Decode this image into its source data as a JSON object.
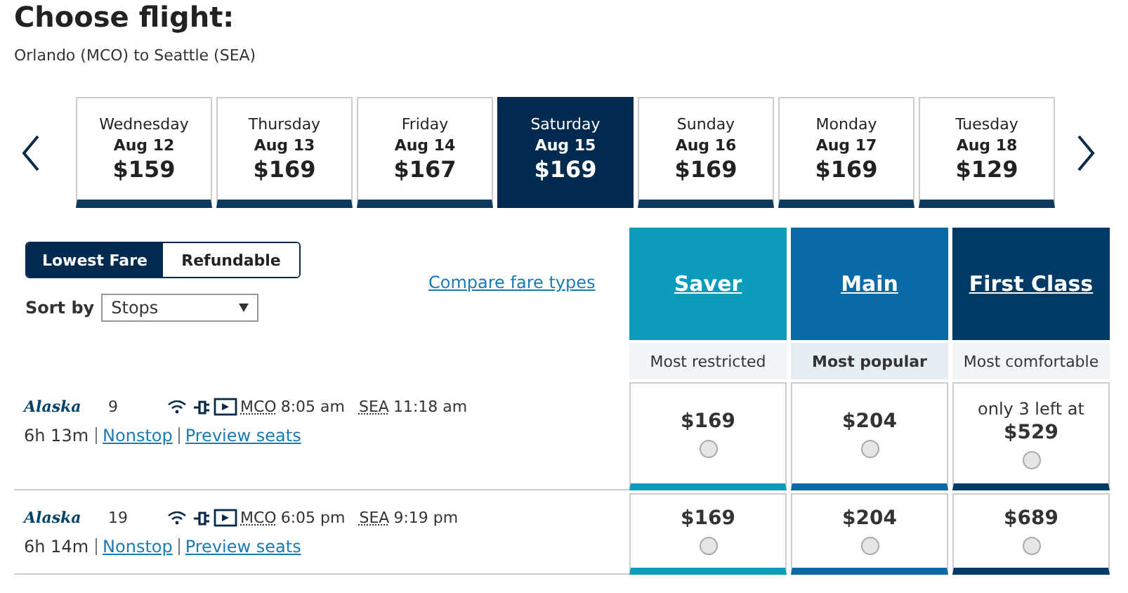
{
  "title": "Choose flight:",
  "route": "Orlando (MCO) to Seattle (SEA)",
  "dates": [
    {
      "day": "Wednesday",
      "date": "Aug 12",
      "price": "$159",
      "selected": false
    },
    {
      "day": "Thursday",
      "date": "Aug 13",
      "price": "$169",
      "selected": false
    },
    {
      "day": "Friday",
      "date": "Aug 14",
      "price": "$167",
      "selected": false
    },
    {
      "day": "Saturday",
      "date": "Aug 15",
      "price": "$169",
      "selected": true
    },
    {
      "day": "Sunday",
      "date": "Aug 16",
      "price": "$169",
      "selected": false
    },
    {
      "day": "Monday",
      "date": "Aug 17",
      "price": "$169",
      "selected": false
    },
    {
      "day": "Tuesday",
      "date": "Aug 18",
      "price": "$129",
      "selected": false
    }
  ],
  "fare_toggle": [
    {
      "label": "Lowest Fare",
      "selected": true
    },
    {
      "label": "Refundable",
      "selected": false
    }
  ],
  "sort": {
    "label": "Sort by",
    "value": "Stops"
  },
  "compare_link": "Compare fare types",
  "fare_columns": [
    {
      "name": "Saver",
      "subtitle": "Most restricted",
      "highlighted": false,
      "color": "#0a9cba"
    },
    {
      "name": "Main",
      "subtitle": "Most popular",
      "highlighted": true,
      "color": "#0a6aa6"
    },
    {
      "name": "First Class",
      "subtitle": "Most comfortable",
      "highlighted": false,
      "color": "#003a66"
    }
  ],
  "flights": [
    {
      "airline": "Alaska",
      "number": "9",
      "origin": "MCO",
      "depart": "8:05 am",
      "destination": "SEA",
      "arrive": "11:18 am",
      "duration": "6h 13m",
      "stops": "Nonstop",
      "seats_link": "Preview seats",
      "fares": [
        {
          "price": "$169",
          "selected": false
        },
        {
          "price": "$204",
          "selected": false
        },
        {
          "note": "only 3 left at",
          "price": "$529",
          "selected": false
        }
      ]
    },
    {
      "airline": "Alaska",
      "number": "19",
      "origin": "MCO",
      "depart": "6:05 pm",
      "destination": "SEA",
      "arrive": "9:19 pm",
      "duration": "6h 14m",
      "stops": "Nonstop",
      "seats_link": "Preview seats",
      "fares": [
        {
          "price": "$169",
          "selected": false
        },
        {
          "price": "$204",
          "selected": false
        },
        {
          "price": "$689",
          "selected": false
        }
      ]
    }
  ]
}
